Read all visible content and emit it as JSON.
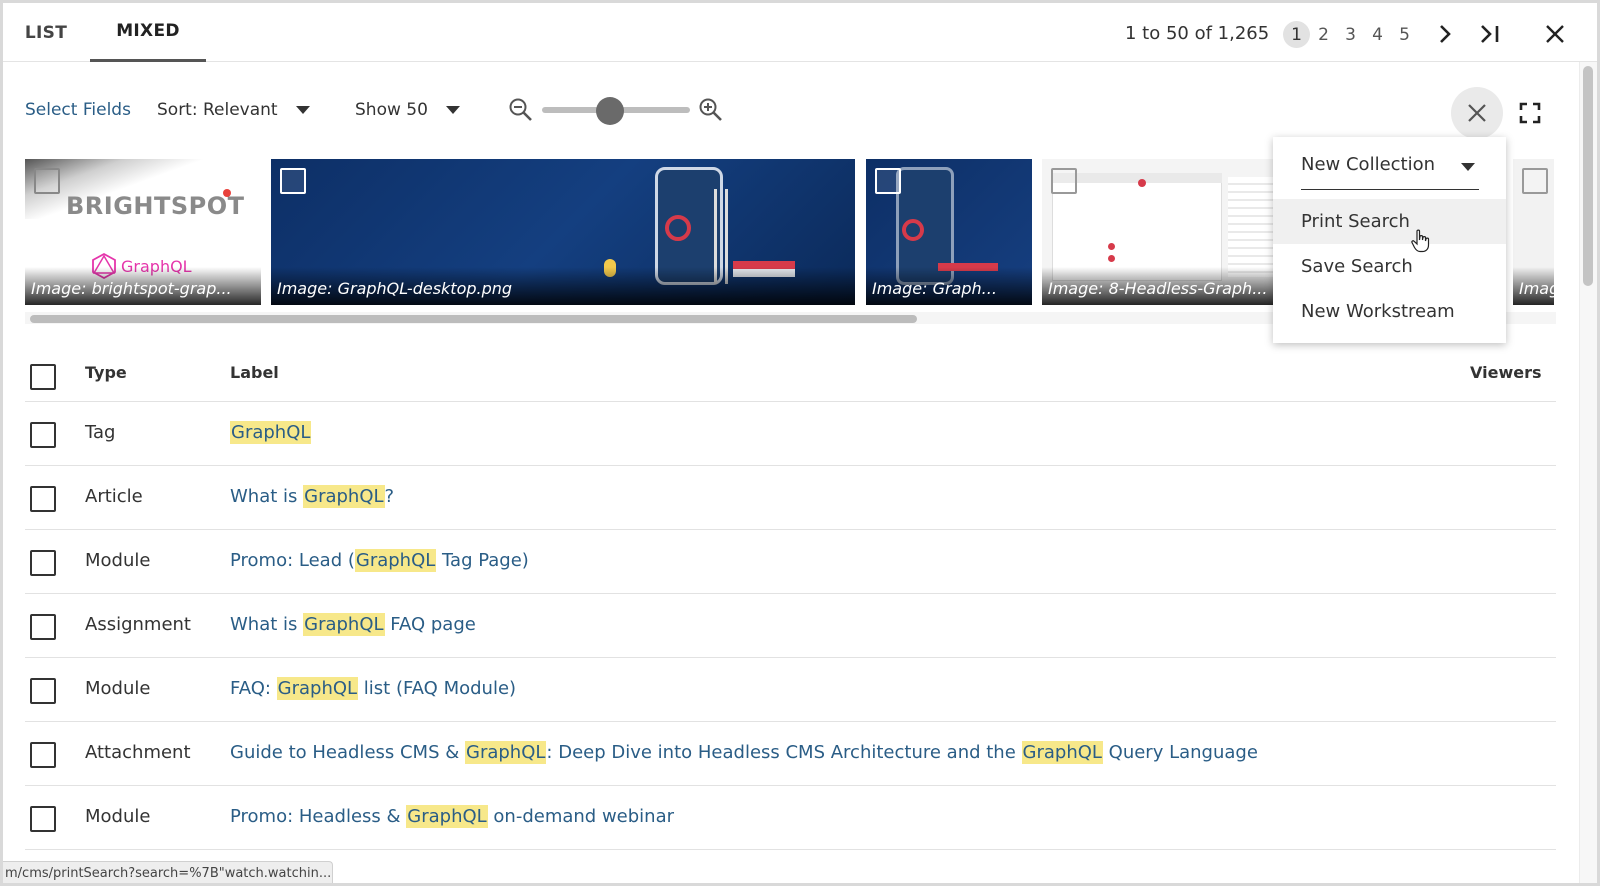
{
  "tabs": [
    {
      "label": "LIST",
      "active": false
    },
    {
      "label": "MIXED",
      "active": true
    }
  ],
  "pagination": {
    "count_text": "1 to 50 of 1,265",
    "pages": [
      "1",
      "2",
      "3",
      "4",
      "5"
    ],
    "current_page": "1"
  },
  "toolbar": {
    "select_fields_label": "Select Fields",
    "sort_label": "Sort: Relevant",
    "show_label": "Show 50",
    "zoom_level": 0.45
  },
  "thumbnails": [
    {
      "caption": "Image: brightspot-grap...",
      "logo_text": "BRIGHTSPOT",
      "logo_sub": "GraphQL"
    },
    {
      "caption": "Image: GraphQL-desktop.png"
    },
    {
      "caption": "Image: Graph..."
    },
    {
      "caption": "Image: 8-Headless-Graph..."
    },
    {
      "caption": "Imag"
    }
  ],
  "menu": {
    "collection_label": "New Collection",
    "items": [
      "Print Search",
      "Save Search",
      "New Workstream"
    ],
    "hovered_item": "Print Search"
  },
  "table": {
    "headers": {
      "type": "Type",
      "label": "Label",
      "viewers": "Viewers"
    },
    "rows": [
      {
        "type": "Tag",
        "label_parts": [
          "",
          "GraphQL",
          ""
        ]
      },
      {
        "type": "Article",
        "label_parts": [
          "What is ",
          "GraphQL",
          "?"
        ]
      },
      {
        "type": "Module",
        "label_parts": [
          "Promo: Lead (",
          "GraphQL",
          " Tag Page)"
        ]
      },
      {
        "type": "Assignment",
        "label_parts": [
          "What is ",
          "GraphQL",
          " FAQ page"
        ]
      },
      {
        "type": "Module",
        "label_parts": [
          "FAQ: ",
          "GraphQL",
          " list (FAQ Module)"
        ]
      },
      {
        "type": "Attachment",
        "label_parts": [
          "Guide to Headless CMS & ",
          "GraphQL",
          ": Deep Dive into Headless CMS Architecture and the ",
          "GraphQL",
          " Query Language"
        ]
      },
      {
        "type": "Module",
        "label_parts": [
          "Promo: Headless & ",
          "GraphQL",
          " on-demand webinar"
        ]
      }
    ]
  },
  "status_bar": "m/cms/printSearch?search=%7B\"watch.watchin...",
  "colors": {
    "link": "#2a5d86",
    "highlight": "#f7e88a",
    "brand_pink": "#e535ab"
  },
  "icons": {
    "next": "chevron-right-icon",
    "last": "last-page-icon",
    "close": "close-icon",
    "zoom_out": "zoom-out-icon",
    "zoom_in": "zoom-in-icon",
    "fullscreen": "fullscreen-icon",
    "cursor": "hand-cursor-icon"
  }
}
